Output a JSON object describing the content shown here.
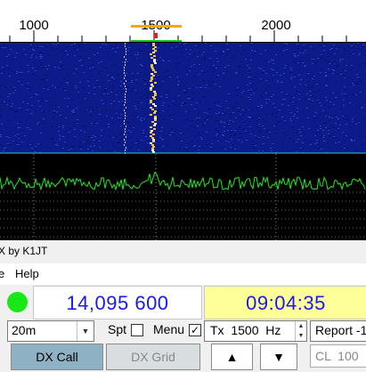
{
  "waterfall": {
    "scale_ticks": [
      "1000",
      "1500",
      "2000"
    ],
    "title_fragment": "X by K1JT"
  },
  "menubar": {
    "items": [
      "e",
      "Help"
    ]
  },
  "status": {
    "indicator_color": "#18e818",
    "frequency": "14,095 600",
    "utc_time": "09:04:35"
  },
  "controls": {
    "band": "20m",
    "spot_label": "Spt",
    "spot_checked": false,
    "menu_label": "Menu",
    "menu_checked": true,
    "menu_check_mark": "✓",
    "tx_freq": "Tx  1500  Hz",
    "report": "Report -1",
    "dx_call_label": "DX Call",
    "dx_grid_label": "DX Grid",
    "up_label": "▲",
    "down_label": "▼",
    "cl_value": "CL  100  °"
  },
  "colors": {
    "waterfall_bg": "#0c1a8a",
    "spectrum": "#1ee81e",
    "freq_text": "#1a1aee",
    "clock_bg": "#ffff99",
    "dx_call_bg": "#8fb1c4",
    "rx_marker": "#f5a800",
    "tx_marker": "#18c818"
  }
}
